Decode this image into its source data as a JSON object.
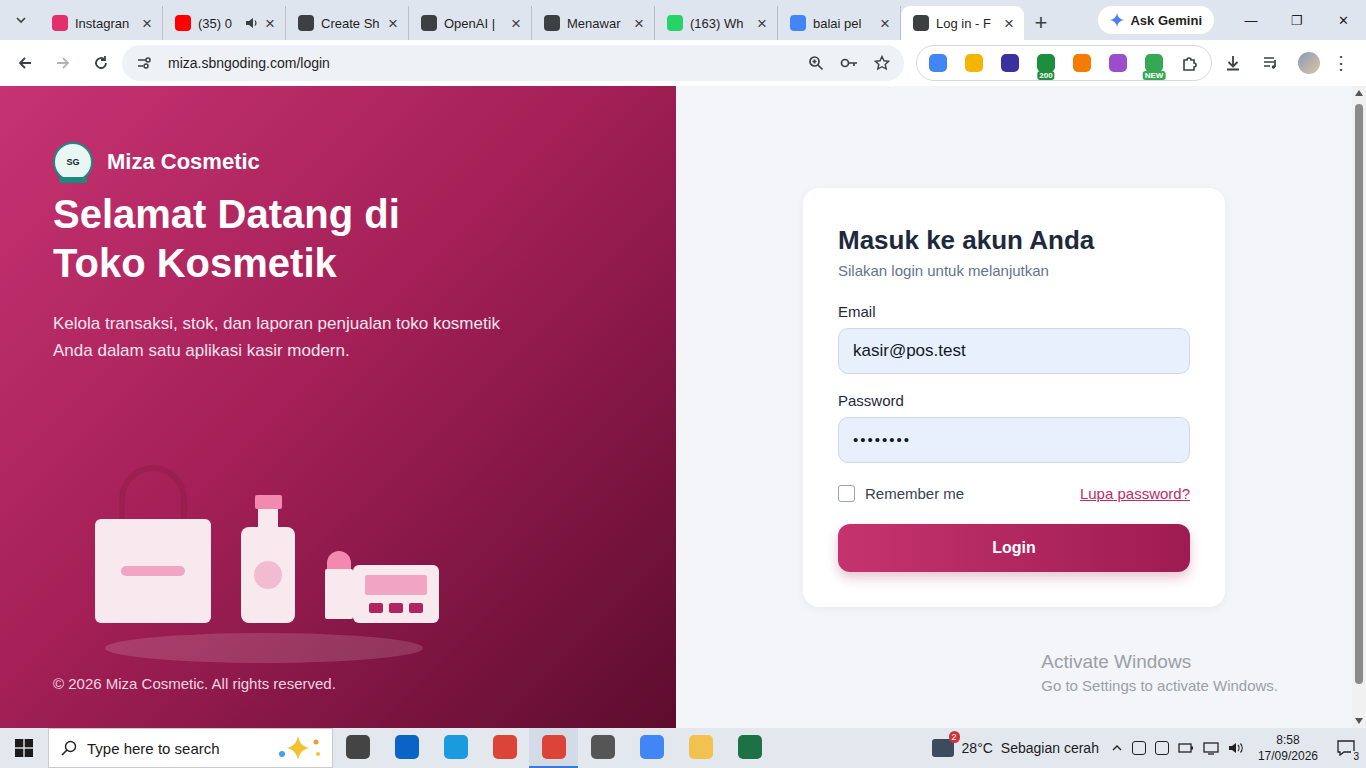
{
  "browser": {
    "tabs": [
      {
        "label": "Instagran",
        "selected": false,
        "audio": false,
        "color": "#e1306c"
      },
      {
        "label": "(35) 0",
        "selected": false,
        "audio": true,
        "color": "#ff0000"
      },
      {
        "label": "Create Sh",
        "selected": false,
        "audio": false,
        "color": "#3c4043"
      },
      {
        "label": "OpenAI |",
        "selected": false,
        "audio": false,
        "color": "#3c4043"
      },
      {
        "label": "Menawar",
        "selected": false,
        "audio": false,
        "color": "#3c4043"
      },
      {
        "label": "(163) Wh",
        "selected": false,
        "audio": false,
        "color": "#25d366"
      },
      {
        "label": "balai pel",
        "selected": false,
        "audio": false,
        "color": "#4285f4"
      },
      {
        "label": "Log in - F",
        "selected": true,
        "audio": false,
        "color": "#3c4043"
      }
    ],
    "close_glyph": "×",
    "new_tab": "+",
    "ask_gemini": "Ask Gemini",
    "window_controls": [
      "—",
      "❐",
      "✕"
    ],
    "url": "miza.sbngoding.com/login",
    "extensions": [
      {
        "color": "#4285f4"
      },
      {
        "color": "#f4b400"
      },
      {
        "color": "#3c2f9e"
      },
      {
        "color": "#1e8e3e",
        "badge": "200"
      },
      {
        "color": "#f57c00"
      },
      {
        "color": "#9c4dcc"
      },
      {
        "color": "#34a853",
        "badge": "NEW"
      }
    ],
    "menu_glyph": "⋮"
  },
  "page": {
    "brand": "Miza Cosmetic",
    "logo_text": "SG",
    "heading": [
      "Selamat Datang di",
      "Toko Kosmetik"
    ],
    "description": "Kelola transaksi, stok, dan laporan penjualan toko kosmetik Anda dalam satu aplikasi kasir modern.",
    "copyright": "© 2026 Miza Cosmetic. All rights reserved.",
    "form": {
      "title": "Masuk ke akun Anda",
      "subtitle": "Silakan login untuk melanjutkan",
      "fields": [
        {
          "label": "Email",
          "value": "kasir@pos.test",
          "kind": "text"
        },
        {
          "label": "Password",
          "value": "••••••••",
          "kind": "password"
        }
      ],
      "remember": {
        "label": "Remember me",
        "checked": false
      },
      "forgot": "Lupa password?",
      "submit": "Login"
    },
    "watermark": [
      "Activate Windows",
      "Go to Settings to activate Windows."
    ],
    "scrollbar": {
      "level": 0.95
    }
  },
  "taskbar": {
    "search_placeholder": "Type here to search",
    "apps": [
      {
        "color": "#444444",
        "active": false
      },
      {
        "color": "#0a64c8",
        "active": false
      },
      {
        "color": "#1a9be0",
        "active": false
      },
      {
        "color": "#db4437",
        "active": false
      },
      {
        "color": "#db4437",
        "active": true
      },
      {
        "color": "#555555",
        "active": false
      },
      {
        "color": "#4285f4",
        "active": false
      },
      {
        "color": "#f2c14e",
        "active": false
      },
      {
        "color": "#1e7145",
        "active": false
      }
    ],
    "weather_badge": "2",
    "temperature": "28°C",
    "weather": "Sebagian cerah",
    "time": "8:58",
    "date": "17/09/2026",
    "notifications": "3"
  }
}
